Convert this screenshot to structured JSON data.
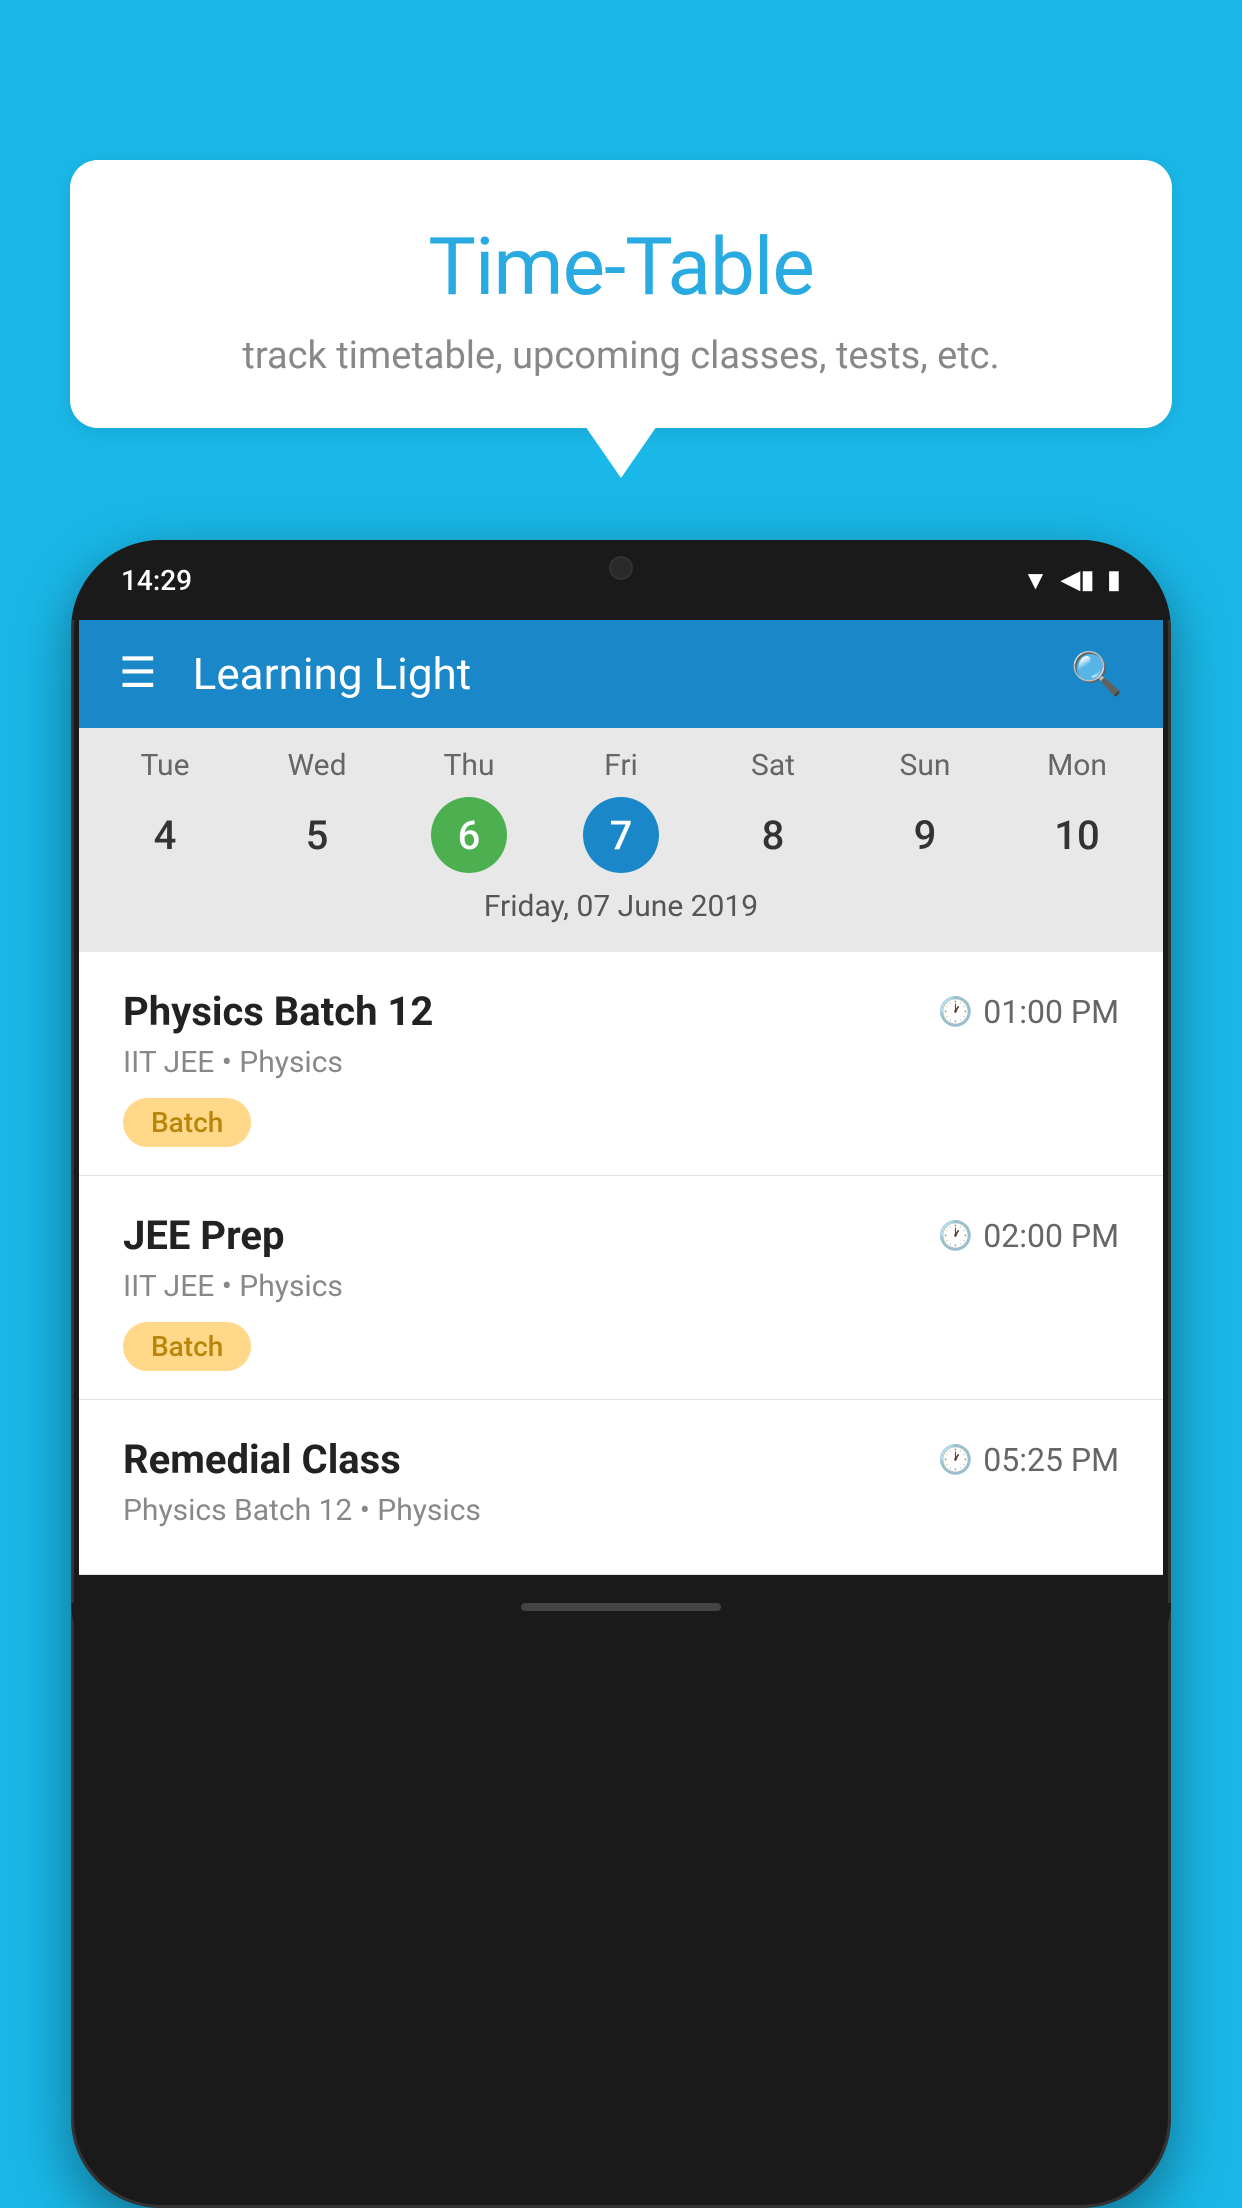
{
  "background_color": "#1ab8e8",
  "tooltip": {
    "title": "Time-Table",
    "subtitle": "track timetable, upcoming classes, tests, etc."
  },
  "phone": {
    "status_bar": {
      "time": "14:29"
    },
    "app_bar": {
      "title": "Learning Light"
    },
    "calendar": {
      "days": [
        {
          "name": "Tue",
          "num": "4",
          "state": "normal"
        },
        {
          "name": "Wed",
          "num": "5",
          "state": "normal"
        },
        {
          "name": "Thu",
          "num": "6",
          "state": "today"
        },
        {
          "name": "Fri",
          "num": "7",
          "state": "selected"
        },
        {
          "name": "Sat",
          "num": "8",
          "state": "normal"
        },
        {
          "name": "Sun",
          "num": "9",
          "state": "normal"
        },
        {
          "name": "Mon",
          "num": "10",
          "state": "normal"
        }
      ],
      "selected_date_label": "Friday, 07 June 2019"
    },
    "schedule": [
      {
        "title": "Physics Batch 12",
        "time": "01:00 PM",
        "subtitle": "IIT JEE • Physics",
        "tag": "Batch"
      },
      {
        "title": "JEE Prep",
        "time": "02:00 PM",
        "subtitle": "IIT JEE • Physics",
        "tag": "Batch"
      },
      {
        "title": "Remedial Class",
        "time": "05:25 PM",
        "subtitle": "Physics Batch 12 • Physics",
        "tag": ""
      }
    ]
  },
  "icons": {
    "hamburger": "☰",
    "search": "🔍",
    "clock": "⏰"
  }
}
